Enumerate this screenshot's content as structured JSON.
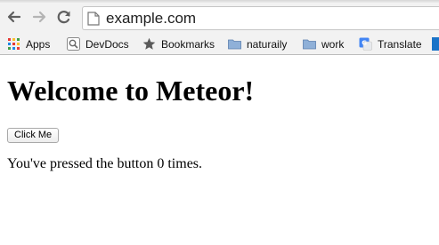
{
  "browser": {
    "address_bar": {
      "url": "example.com"
    },
    "bookmarks": [
      {
        "label": "Apps",
        "icon": "apps-grid-icon"
      },
      {
        "label": "DevDocs",
        "icon": "devdocs-icon"
      },
      {
        "label": "Bookmarks",
        "icon": "star-icon"
      },
      {
        "label": "naturaily",
        "icon": "folder-icon"
      },
      {
        "label": "work",
        "icon": "folder-icon"
      },
      {
        "label": "Translate",
        "icon": "google-translate-icon"
      }
    ]
  },
  "page": {
    "title": "Welcome to Meteor!",
    "button_label": "Click Me",
    "counter_prefix": "You've pressed the button",
    "counter_value": "0",
    "counter_suffix": "times."
  },
  "colors": {
    "toolbar_bg": "#f2f2f2",
    "folder_blue": "#7a9cc6",
    "accent_blue": "#1a73c8"
  }
}
